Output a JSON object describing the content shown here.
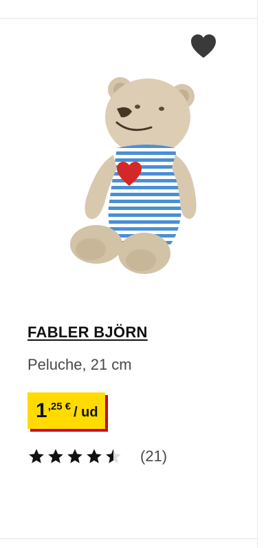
{
  "product": {
    "name": "FABLER BJÖRN",
    "description": "Peluche, 21 cm",
    "price": {
      "integer": "1",
      "decimal": ",25 €",
      "unit": "/ ud"
    },
    "rating": {
      "stars": 4.5,
      "count_label": "(21)"
    }
  },
  "icons": {
    "favorite": "heart-icon",
    "star": "star-icon"
  },
  "colors": {
    "price_bg": "#ffdb00",
    "price_shadow": "#cc0008",
    "heart": "#3a3a3a"
  }
}
